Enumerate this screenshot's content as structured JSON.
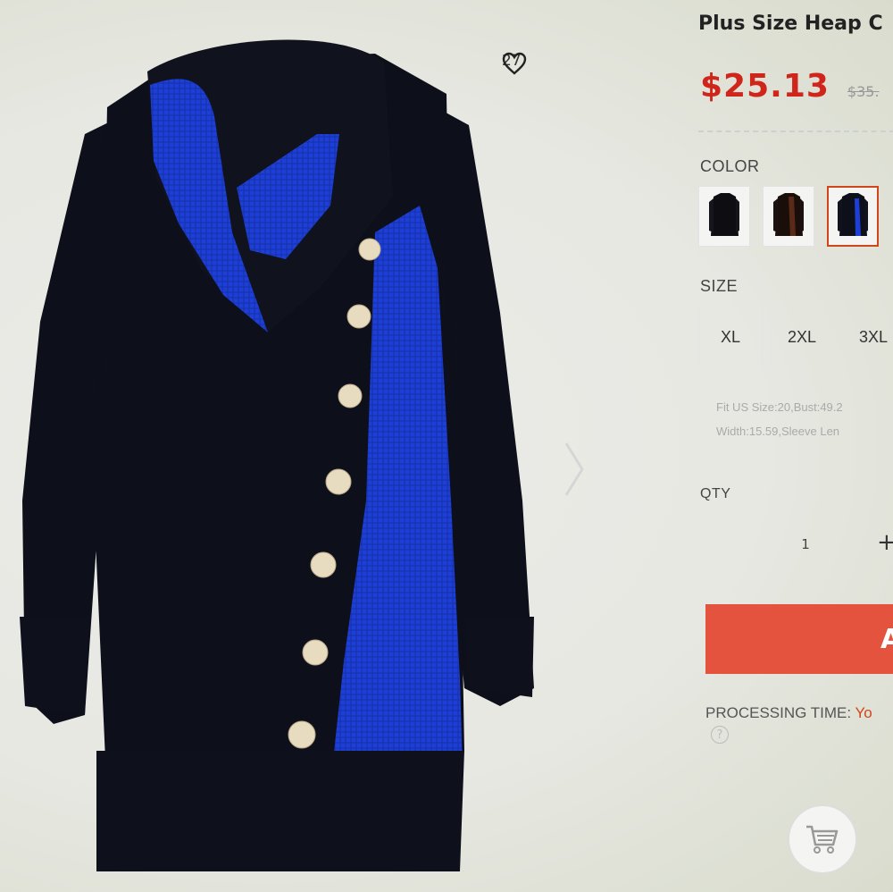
{
  "product": {
    "title": "Plus Size Heap C",
    "price": "$25.13",
    "old_price": "$35.",
    "wishlist_count": "27"
  },
  "options": {
    "color_label": "COLOR",
    "swatches": [
      "black-variant",
      "brown-variant",
      "blue-variant"
    ],
    "selected_swatch_index": 2,
    "size_label": "SIZE",
    "sizes": [
      "XL",
      "2XL",
      "3XL"
    ]
  },
  "fit": {
    "line1": "Fit US Size:20,Bust:49.2",
    "line2": "Width:15.59,Sleeve Len"
  },
  "quantity": {
    "label": "QTY",
    "value": "1",
    "plus": "+"
  },
  "cart": {
    "add_button": "A"
  },
  "processing": {
    "label": "PROCESSING TIME:",
    "value": "Yo",
    "help": "?"
  },
  "icons": {
    "wishlist": "heart-outline-icon",
    "next": "chevron-right-icon",
    "cart": "shopping-cart-icon",
    "help": "question-circle-icon"
  },
  "colors": {
    "price": "#d0251a",
    "add_button": "#e4533d",
    "garment_body": "#0d0f1a",
    "garment_accent": "#1d3fd6",
    "selected_border": "#d0451a"
  }
}
